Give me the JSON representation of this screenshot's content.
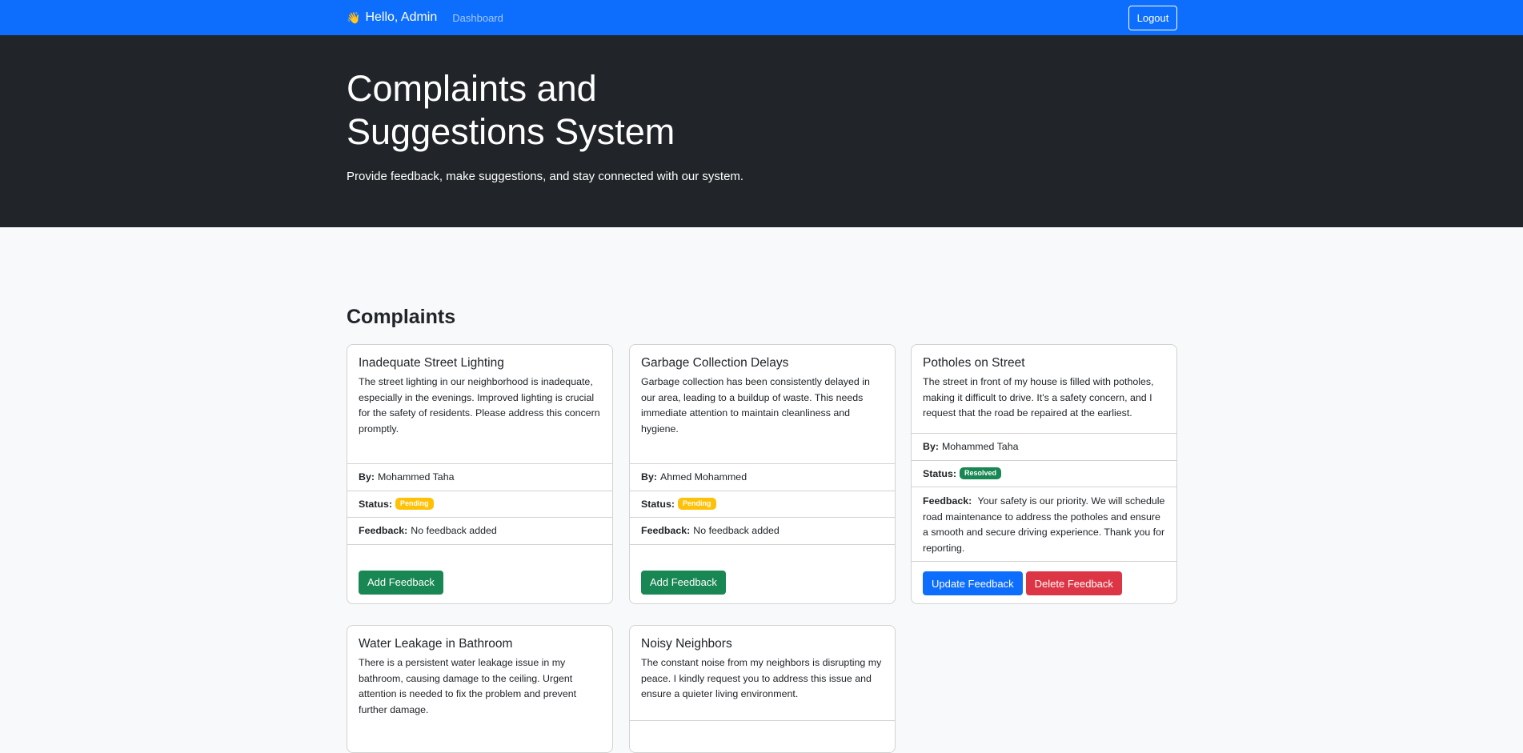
{
  "navbar": {
    "wave_icon": "👋",
    "greeting": "Hello, Admin",
    "dashboard_link": "Dashboard",
    "logout_label": "Logout",
    "bg_color": "#0d6efd"
  },
  "hero": {
    "title": "Complaints and Suggestions System",
    "subtitle": "Provide feedback, make suggestions, and stay connected with our system."
  },
  "section_title": "Complaints",
  "labels": {
    "by": "By:",
    "status": "Status:",
    "feedback": "Feedback:"
  },
  "cards": [
    {
      "title": "Inadequate Street Lighting",
      "text": "The street lighting in our neighborhood is inadequate, especially in the evenings. Improved lighting is crucial for the safety of residents. Please address this concern promptly.",
      "by": "Mohammed Taha",
      "status": "Pending",
      "feedback": "No feedback added",
      "action": "Add Feedback"
    },
    {
      "title": "Garbage Collection Delays",
      "text": "Garbage collection has been consistently delayed in our area, leading to a buildup of waste. This needs immediate attention to maintain cleanliness and hygiene.",
      "by": "Ahmed Mohammed",
      "status": "Pending",
      "feedback": "No feedback added",
      "action": "Add Feedback"
    },
    {
      "title": "Potholes on Street",
      "text": "The street in front of my house is filled with potholes, making it difficult to drive. It's a safety concern, and I request that the road be repaired at the earliest.",
      "by": "Mohammed Taha",
      "status": "Resolved",
      "feedback": "Your safety is our priority. We will schedule road maintenance to address the potholes and ensure a smooth and secure driving experience. Thank you for reporting.",
      "update_action": "Update Feedback",
      "delete_action": "Delete Feedback"
    },
    {
      "title": "Water Leakage in Bathroom",
      "text": "There is a persistent water leakage issue in my bathroom, causing damage to the ceiling. Urgent attention is needed to fix the problem and prevent further damage."
    },
    {
      "title": "Noisy Neighbors",
      "text": "The constant noise from my neighbors is disrupting my peace. I kindly request you to address this issue and ensure a quieter living environment."
    }
  ],
  "colors": {
    "pending": "#ffc107",
    "resolved": "#198754",
    "add": "#198754",
    "update": "#0d6efd",
    "delete": "#dc3545",
    "hero_bg": "#212529"
  }
}
